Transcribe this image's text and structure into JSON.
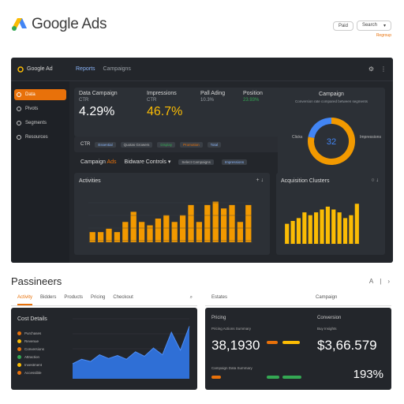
{
  "brand": {
    "title": "Google Ads"
  },
  "top_controls": {
    "left": "Paid",
    "select": "Search",
    "orange_link": "Regroup"
  },
  "dash": {
    "app_name": "Google Ad",
    "tabs": [
      "Reports",
      "Campaigns"
    ],
    "sidebar": [
      "Data",
      "Pivots",
      "Segments",
      "Resources"
    ],
    "kpis": [
      {
        "label": "Data Campaign",
        "sub": "CTR",
        "value": "4.29%",
        "color": "#ffffff"
      },
      {
        "label": "Impressions",
        "sub": "CTR",
        "value": "46.7%",
        "color": "#fbbc04"
      },
      {
        "label": "Pall Ading",
        "sub": "10.3%",
        "value": "",
        "color": "#ffffff"
      },
      {
        "label": "Position",
        "sub": "23.93%",
        "value": "",
        "color": "#34a853"
      }
    ],
    "strip": {
      "label": "CTR",
      "chips": [
        "Essential",
        "Quotas Growers",
        "Display",
        "Promotion",
        "Total"
      ]
    },
    "row2": {
      "a": "Campaign",
      "a_accent": "Ads",
      "b": "Bidware Controls",
      "chips": [
        "Select Campaigns",
        "Impressions"
      ]
    },
    "donut": {
      "title": "Campaign",
      "subtitle": "Conversion rate compared between segments",
      "value": "32",
      "left_label": "Clicks",
      "right_label": "Impressions"
    },
    "chart1": {
      "title": "Activities",
      "icon": "+ ↓"
    },
    "chart2": {
      "title": "Acquisition Clusters",
      "icon": "○ ↓"
    }
  },
  "lower": {
    "title": "Passineers",
    "tabs": [
      "Activity",
      "Bidders",
      "Products",
      "Pricing",
      "Checkout"
    ],
    "chart_title": "Cost Details",
    "legend": [
      {
        "label": "Purchases",
        "color": "#e8710a"
      },
      {
        "label": "Revenue",
        "color": "#fbbc04"
      },
      {
        "label": "Conversions",
        "color": "#e8710a"
      },
      {
        "label": "Attraction",
        "color": "#34a853"
      },
      {
        "label": "Investment",
        "color": "#fbbc04"
      },
      {
        "label": "Accessible",
        "color": "#e8710a"
      }
    ],
    "right_tabs": [
      "Estates",
      "Campaign"
    ],
    "stats": {
      "c1": "Pricing",
      "c2": "Conversion",
      "sub1": "Pricing Actions Summary",
      "sub2": "Buy Insights",
      "n1": "38,1930",
      "n2": "$3,66.579",
      "pct": "193%",
      "foot": "Campaign Data Summary"
    }
  },
  "chart_data": [
    {
      "type": "bar",
      "title": "Activities",
      "values": [
        3,
        3,
        4,
        3,
        6,
        9,
        6,
        5,
        7,
        8,
        6,
        8,
        11,
        6,
        11,
        12,
        10,
        11,
        6,
        11
      ],
      "ylim": [
        0,
        14
      ]
    },
    {
      "type": "bar",
      "title": "Acquisition Clusters",
      "values": [
        7,
        8,
        9,
        11,
        10,
        11,
        12,
        13,
        12,
        11,
        9,
        10,
        14
      ],
      "ylim": [
        0,
        16
      ]
    },
    {
      "type": "area",
      "title": "Cost Details",
      "values": [
        2,
        2.6,
        2.3,
        3.2,
        2.7,
        3.1,
        2.6,
        3.6,
        3.0,
        4.1,
        3.2,
        6.2,
        3.8,
        7.0
      ],
      "ylim": [
        0,
        8
      ]
    },
    {
      "type": "pie",
      "title": "Campaign",
      "values": [
        78,
        22
      ],
      "labels": [
        "Clicks",
        "Impressions"
      ]
    }
  ]
}
